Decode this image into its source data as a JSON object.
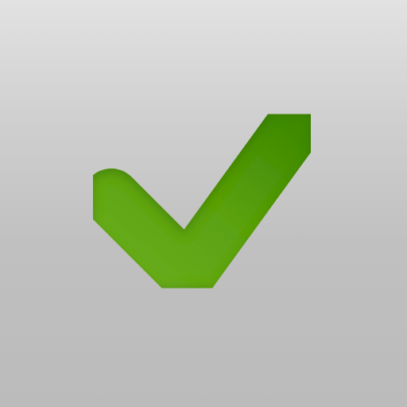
{
  "icon": {
    "name": "checkmark-icon",
    "colors": {
      "check_light": "#6aae1e",
      "check_dark": "#3f8a00",
      "shadow": "#2f6a00",
      "background_top": "#e2e2e2",
      "background_bottom": "#bbbbbb"
    }
  }
}
